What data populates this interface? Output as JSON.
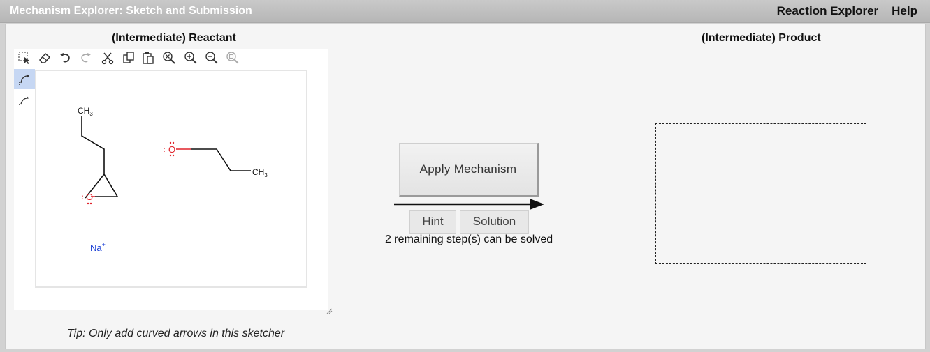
{
  "app": {
    "title": "Mechanism Explorer: Sketch and Submission",
    "menu": [
      "Reaction Explorer",
      "Help"
    ]
  },
  "reactant_panel": {
    "heading": "(Intermediate) Reactant",
    "toolbar_icons": [
      "select-icon",
      "eraser-icon",
      "undo-icon",
      "redo-icon",
      "cut-icon",
      "copy-icon",
      "paste-icon",
      "zoom-reset-icon",
      "zoom-in-icon",
      "zoom-out-icon",
      "zoom-fit-icon"
    ],
    "side_tools": [
      "curved-arrow-electron-pair-icon",
      "curved-arrow-single-electron-icon"
    ],
    "molecules": {
      "epoxide_ch3": "CH",
      "epoxide_ch3_sub": "3",
      "epoxide_oxygen": "O",
      "alkoxide_oxygen": "O",
      "alkoxide_charge": "−",
      "alkoxide_ch3": "CH",
      "alkoxide_ch3_sub": "3",
      "sodium": "Na",
      "sodium_charge": "+",
      "lone_pair_mark": ":"
    },
    "tip": "Tip: Only add curved arrows in this sketcher"
  },
  "center": {
    "apply_label": "Apply Mechanism",
    "hint_label": "Hint",
    "solution_label": "Solution",
    "remaining_text": "2 remaining step(s) can be solved"
  },
  "product_panel": {
    "heading": "(Intermediate) Product"
  },
  "colors": {
    "atom_oxygen": "#e0222a",
    "atom_sodium": "#1a3fd6",
    "bond": "#111111",
    "active_tool_bg": "#c6d7f3"
  }
}
